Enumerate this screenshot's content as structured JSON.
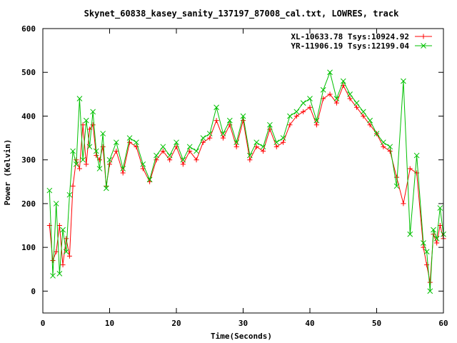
{
  "chart_data": {
    "type": "line",
    "title": "Skynet_60838_kasey_sanity_137197_87008_cal.txt, LOWRES, track",
    "xlabel": "Time(Seconds)",
    "ylabel": "Power (Kelvin)",
    "xlim": [
      0,
      60
    ],
    "ylim": [
      -50,
      600
    ],
    "xticks": [
      0,
      10,
      20,
      30,
      40,
      50,
      60
    ],
    "yticks": [
      0,
      100,
      200,
      300,
      400,
      500,
      600
    ],
    "legend_position": "top-right",
    "grid": false,
    "series": [
      {
        "name": "XL-10633.78 Tsys:10924.92",
        "color": "#ff0000",
        "marker": "plus",
        "x": [
          1.0,
          1.5,
          2.0,
          2.5,
          3.0,
          3.5,
          4.0,
          4.5,
          5.0,
          5.5,
          6.0,
          6.5,
          7.0,
          7.5,
          8.0,
          8.5,
          9.0,
          9.5,
          10.0,
          11.0,
          12.0,
          13.0,
          14.0,
          15.0,
          16.0,
          17.0,
          18.0,
          19.0,
          20.0,
          21.0,
          22.0,
          23.0,
          24.0,
          25.0,
          26.0,
          27.0,
          28.0,
          29.0,
          30.0,
          31.0,
          32.0,
          33.0,
          34.0,
          35.0,
          36.0,
          37.0,
          38.0,
          39.0,
          40.0,
          41.0,
          42.0,
          43.0,
          44.0,
          45.0,
          46.0,
          47.0,
          48.0,
          49.0,
          50.0,
          51.0,
          52.0,
          53.0,
          54.0,
          55.0,
          56.0,
          57.0,
          57.5,
          58.0,
          58.5,
          59.0,
          59.5,
          60.0
        ],
        "y": [
          150,
          70,
          90,
          150,
          60,
          120,
          80,
          240,
          300,
          280,
          380,
          290,
          370,
          380,
          310,
          300,
          330,
          240,
          290,
          320,
          270,
          340,
          330,
          280,
          250,
          300,
          320,
          300,
          330,
          290,
          320,
          300,
          340,
          350,
          390,
          350,
          380,
          330,
          390,
          300,
          330,
          320,
          370,
          330,
          340,
          380,
          400,
          410,
          420,
          380,
          440,
          450,
          430,
          470,
          440,
          420,
          400,
          380,
          360,
          330,
          320,
          260,
          200,
          280,
          270,
          100,
          60,
          20,
          130,
          110,
          150,
          120
        ]
      },
      {
        "name": "YR-11906.19 Tsys:12199.04",
        "color": "#00c000",
        "marker": "cross",
        "x": [
          1.0,
          1.5,
          2.0,
          2.5,
          3.0,
          3.5,
          4.0,
          4.5,
          5.0,
          5.5,
          6.0,
          6.5,
          7.0,
          7.5,
          8.0,
          8.5,
          9.0,
          9.5,
          10.0,
          11.0,
          12.0,
          13.0,
          14.0,
          15.0,
          16.0,
          17.0,
          18.0,
          19.0,
          20.0,
          21.0,
          22.0,
          23.0,
          24.0,
          25.0,
          26.0,
          27.0,
          28.0,
          29.0,
          30.0,
          31.0,
          32.0,
          33.0,
          34.0,
          35.0,
          36.0,
          37.0,
          38.0,
          39.0,
          40.0,
          41.0,
          42.0,
          43.0,
          44.0,
          45.0,
          46.0,
          47.0,
          48.0,
          49.0,
          50.0,
          51.0,
          52.0,
          53.0,
          54.0,
          55.0,
          56.0,
          57.0,
          57.5,
          58.0,
          58.5,
          59.0,
          59.5,
          60.0
        ],
        "y": [
          230,
          35,
          200,
          40,
          140,
          90,
          220,
          320,
          290,
          440,
          300,
          390,
          330,
          410,
          320,
          280,
          360,
          235,
          300,
          340,
          280,
          350,
          340,
          290,
          255,
          310,
          330,
          310,
          340,
          300,
          330,
          320,
          350,
          360,
          420,
          360,
          390,
          340,
          400,
          310,
          340,
          330,
          380,
          340,
          350,
          400,
          410,
          430,
          440,
          390,
          460,
          500,
          440,
          480,
          450,
          430,
          410,
          390,
          360,
          340,
          330,
          240,
          480,
          130,
          310,
          110,
          90,
          0,
          140,
          120,
          190,
          130
        ]
      }
    ]
  }
}
